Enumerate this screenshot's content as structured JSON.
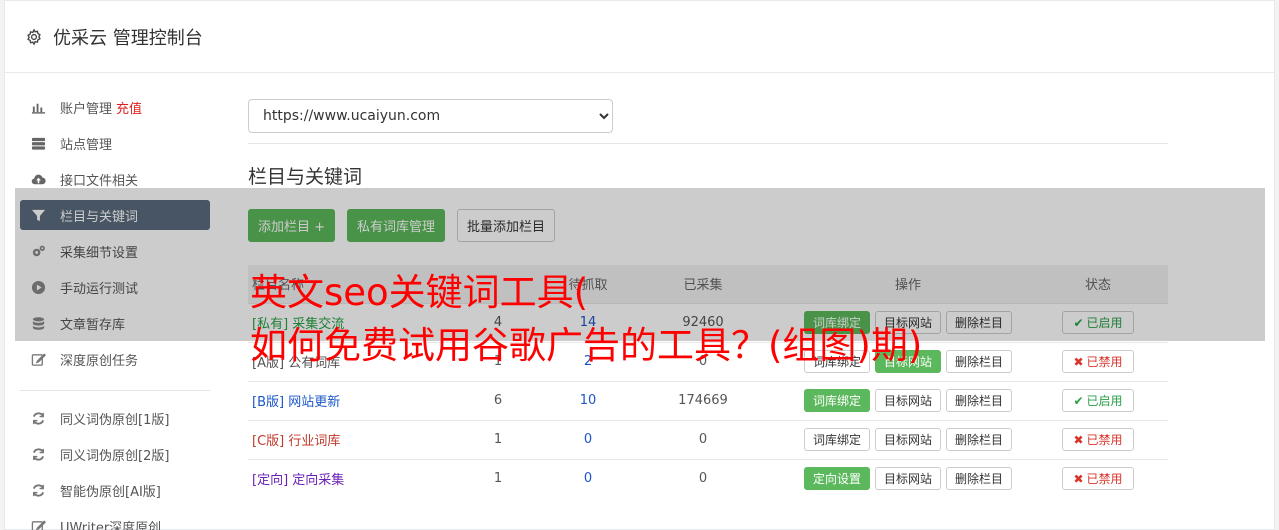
{
  "app": {
    "title": "优采云 管理控制台"
  },
  "sidebar": {
    "items": [
      {
        "label": "账户管理",
        "badge": "充值",
        "icon": "bar-chart-icon"
      },
      {
        "label": "站点管理",
        "icon": "server-icon"
      },
      {
        "label": "接口文件相关",
        "icon": "cloud-upload-icon"
      },
      {
        "label": "栏目与关键词",
        "icon": "filter-icon"
      },
      {
        "label": "采集细节设置",
        "icon": "cogs-icon"
      },
      {
        "label": "手动运行测试",
        "icon": "play-circle-icon"
      },
      {
        "label": "文章暂存库",
        "icon": "database-icon"
      },
      {
        "label": "深度原创任务",
        "icon": "edit-icon"
      }
    ],
    "items2": [
      {
        "label": "同义词伪原创[1版]",
        "icon": "refresh-icon"
      },
      {
        "label": "同义词伪原创[2版]",
        "icon": "refresh-icon"
      },
      {
        "label": "智能伪原创[AI版]",
        "icon": "refresh-icon"
      },
      {
        "label": "UWriter深度原创",
        "icon": "edit-icon"
      }
    ]
  },
  "main": {
    "site_select": "https://www.ucaiyun.com",
    "section_title": "栏目与关键词",
    "buttons": {
      "add": "添加栏目 +",
      "private": "私有词库管理",
      "batch": "批量添加栏目"
    },
    "table": {
      "headers": [
        "栏目名称",
        "",
        "待抓取",
        "已采集",
        "操作",
        "状态"
      ],
      "rows": [
        {
          "tag": "[私有]",
          "name": "采集交流",
          "col1": "4",
          "col2": "14",
          "col3": "92460",
          "op1": "词库绑定",
          "op2": "目标网站",
          "op3": "删除栏目",
          "status": "已启用"
        },
        {
          "tag": "[A版]",
          "name": "公有词库",
          "col1": "1",
          "col2": "2",
          "col3": "0",
          "op1": "词库绑定",
          "op2": "目标网站",
          "op3": "删除栏目",
          "status": "已禁用"
        },
        {
          "tag": "[B版]",
          "name": "网站更新",
          "col1": "6",
          "col2": "10",
          "col3": "174669",
          "op1": "词库绑定",
          "op2": "目标网站",
          "op3": "删除栏目",
          "status": "已启用"
        },
        {
          "tag": "[C版]",
          "name": "行业词库",
          "col1": "1",
          "col2": "0",
          "col3": "0",
          "op1": "词库绑定",
          "op2": "目标网站",
          "op3": "删除栏目",
          "status": "已禁用"
        },
        {
          "tag": "[定向]",
          "name": "定向采集",
          "col1": "1",
          "col2": "0",
          "col3": "0",
          "op1": "定向设置",
          "op2": "目标网站",
          "op3": "删除栏目",
          "status": "已禁用"
        }
      ]
    }
  },
  "overlay": {
    "headline_line1": "英文seo关键词工具(",
    "headline_line2": "如何免费试用谷歌广告的工具？(组图)期)"
  },
  "colors": {
    "accent": "#5cb85c",
    "active_nav": "#5a6b7e",
    "headline": "#ff0000"
  }
}
